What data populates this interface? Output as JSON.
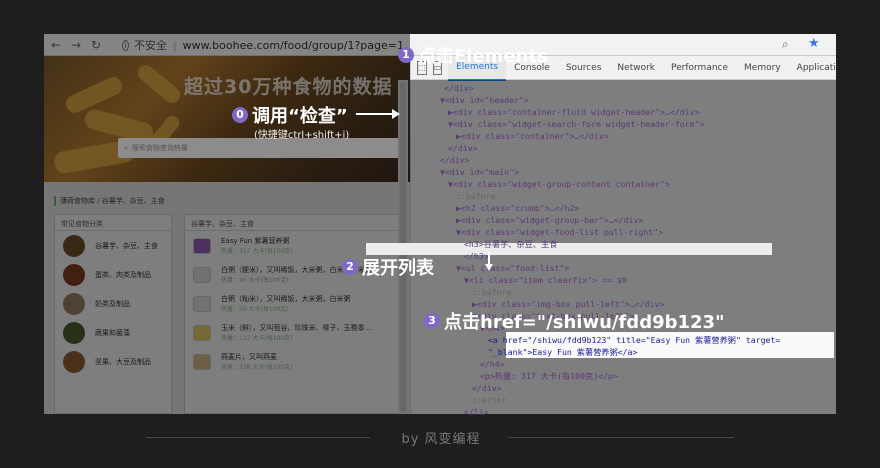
{
  "browser": {
    "insecure_label": "不安全",
    "separator": "|",
    "url": "www.boohee.com/food/group/1?page=1",
    "zoom_icon": "magnifier-icon",
    "star_icon": "star-icon"
  },
  "page": {
    "hero_title": "超过30万种食物的数据",
    "search_placeholder": "搜索食物查询热量",
    "breadcrumb": "薄荷食物库 / 谷薯芋、杂豆、主食",
    "left_panel_title": "常见食物分类",
    "categories": [
      "谷薯芋、杂豆、主食",
      "蛋类、肉类及制品",
      "奶类及制品",
      "蔬果和菌藻",
      "坚果、大豆及制品"
    ],
    "right_panel_title": "谷薯芋、杂豆、主食",
    "foods": [
      {
        "name": "Easy Fun 紫薯营养粥",
        "sub": "热量：317 大卡(每100克)"
      },
      {
        "name": "白粥（粳米），又叫稀饭，大米粥，白米粥，米粥",
        "sub": "热量：46 大卡(每100克)"
      },
      {
        "name": "白粥（籼米），又叫稀饭，大米粥，白米粥",
        "sub": "热量：59 大卡(每100克)"
      },
      {
        "name": "玉米（鲜），又叫苞谷、珍珠米、棒子、玉蜀黍...",
        "sub": "热量：112 大卡(每100克)"
      },
      {
        "name": "燕麦片，又叫燕麦",
        "sub": "热量：338 大卡(每100克)"
      }
    ]
  },
  "devtools": {
    "tabs": [
      "Elements",
      "Console",
      "Sources",
      "Network",
      "Performance",
      "Memory",
      "Application"
    ],
    "active_tab": "Elements"
  },
  "code_lines": [
    {
      "t": "</div>"
    },
    {
      "t": "▼<div id=\"header\">"
    },
    {
      "t": "▶<div class=\"container-fluid widget-header\">…</div>"
    },
    {
      "t": "▼<div class=\"widget-search-form widget-header-form\">"
    },
    {
      "t": "▶<div class=\"container\">…</div>"
    },
    {
      "t": "</div>"
    },
    {
      "t": "</div>"
    },
    {
      "t": "▼<div id=\"main\">"
    },
    {
      "t": "▼<div class=\"widget-group-content container\">"
    },
    {
      "t": "::before"
    },
    {
      "t": "▶<h2 class=\"crumb\">…</h2>"
    },
    {
      "t": "▶<div class=\"widget-group-bar\">…</div>"
    },
    {
      "t": "▼<div class=\"widget-food-list pull-right\">"
    },
    {
      "t": "<h3>谷薯芋、杂豆、主食"
    },
    {
      "t": "</h3>"
    },
    {
      "t": "▼<ul class=\"food-list\">"
    },
    {
      "t": "▼<li class=\"item clearfix\"> == $0"
    },
    {
      "t": "::before"
    },
    {
      "t": "▶<div class=\"img-box pull-left\">…</div>"
    },
    {
      "t": "▼<div class=\"text-box pull-left\">"
    },
    {
      "t": "▼<h4>"
    },
    {
      "t": "<a href=\"/shiwu/fdd9b123\" title=\"Easy Fun 紫薯营养粥\" target="
    },
    {
      "t": "\"_blank\">Easy Fun 紫薯营养粥</a>"
    },
    {
      "t": "</h4>"
    },
    {
      "t": "<p>热量: 317 大卡(每100克)</p>"
    },
    {
      "t": "</div>"
    },
    {
      "t": "::after"
    },
    {
      "t": "</li>"
    }
  ],
  "annotations": {
    "step0_num": "0",
    "step0_text": "调用“检查”",
    "step0_sub": "(快捷键ctrl+shift+i)",
    "step1_num": "1",
    "step1_text": "点击Elements",
    "step2_num": "2",
    "step2_text": "展开列表",
    "step3_num": "3",
    "step3_text": "点击href=\"/shiwu/fdd9b123\""
  },
  "footer": {
    "credit": "by 风变编程"
  }
}
